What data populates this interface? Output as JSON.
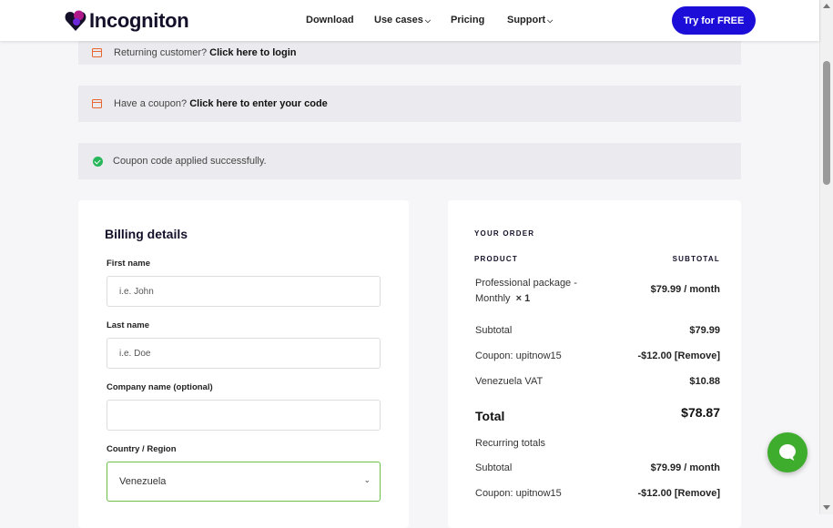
{
  "header": {
    "brand": "Incogniton",
    "nav": [
      {
        "label": "Download"
      },
      {
        "label": "Use cases",
        "dropdown": true
      },
      {
        "label": "Pricing"
      },
      {
        "label": "Support",
        "dropdown": true
      }
    ],
    "cta_label": "Try for FREE",
    "colors": {
      "accent": "#1c0ed8",
      "brand_purple": "#6d28d9",
      "success": "#27b65a"
    }
  },
  "notices": {
    "login": {
      "text": "Returning customer? ",
      "link": "Click here to login"
    },
    "coupon": {
      "text": "Have a coupon? ",
      "link": "Click here to enter your code"
    },
    "success": {
      "text": "Coupon code applied successfully."
    }
  },
  "billing": {
    "title": "Billing details",
    "first_name": {
      "label": "First name",
      "placeholder": "i.e. John"
    },
    "last_name": {
      "label": "Last name",
      "placeholder": "i.e. Doe"
    },
    "company": {
      "label": "Company name (optional)",
      "value": ""
    },
    "country": {
      "label": "Country / Region",
      "value": "Venezuela"
    }
  },
  "order": {
    "heading": "YOUR ORDER",
    "col_product": "PRODUCT",
    "col_subtotal": "SUBTOTAL",
    "product_name": "Professional package - Monthly",
    "product_qty": "× 1",
    "product_price": "$79.99 / month",
    "rows": [
      {
        "label": "Subtotal",
        "value": "$79.99"
      },
      {
        "label": "Coupon: upitnow15",
        "value": "-$12.00 [Remove]"
      },
      {
        "label": "Venezuela VAT",
        "value": "$10.88"
      }
    ],
    "total_label": "Total",
    "total_value": "$78.87",
    "recurring_label": "Recurring totals",
    "recurring_rows": [
      {
        "label": "Subtotal",
        "value": "$79.99 / month"
      },
      {
        "label": "Coupon: upitnow15",
        "value": "-$12.00 [Remove]"
      }
    ]
  },
  "icons": [
    "logo-icon",
    "calendar-icon",
    "check-circle-icon",
    "chevron-down-icon",
    "chat-icon"
  ]
}
